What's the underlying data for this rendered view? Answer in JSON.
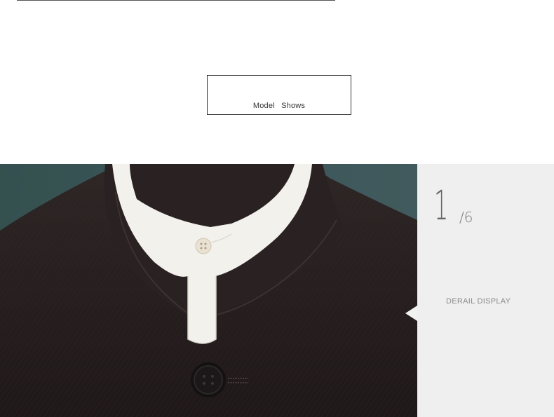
{
  "section_heading": "Model   Shows",
  "gallery": {
    "current": "1",
    "total": "/6",
    "label": "DERAIL DISPLAY"
  },
  "colors": {
    "jacket": "#2d2424",
    "backdrop": "#3b5557",
    "shirt": "#f3f1ec",
    "panel": "#efefef"
  },
  "photo": {
    "subject": "black-stand-collar-jacket-on-mannequin"
  }
}
